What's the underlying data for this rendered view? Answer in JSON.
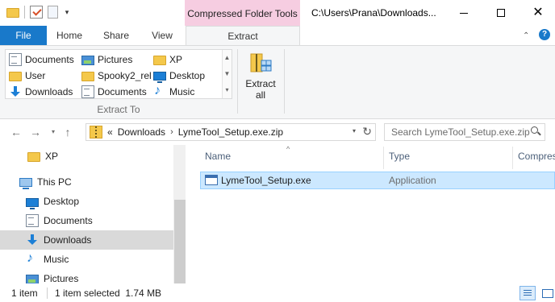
{
  "quick_access_toolbar": {
    "dropdown_glyph": "▾"
  },
  "ribbon_context": {
    "title": "Compressed Folder Tools"
  },
  "window": {
    "title": "C:\\Users\\Prana\\Downloads..."
  },
  "window_controls": {
    "minimize": "minimize",
    "maximize": "maximize",
    "close_glyph": "✕"
  },
  "ribbon_tabs": {
    "file": "File",
    "home": "Home",
    "share": "Share",
    "view": "View",
    "extract": "Extract",
    "active": "Extract"
  },
  "ribbon_right": {
    "collapse_glyph": "⌃",
    "help_glyph": "?"
  },
  "extract_to": {
    "group_label": "Extract To",
    "items": [
      {
        "label": "Documents",
        "icon": "documents-icon"
      },
      {
        "label": "Pictures",
        "icon": "pictures-icon"
      },
      {
        "label": "XP",
        "icon": "folder-icon"
      },
      {
        "label": "User",
        "icon": "folder-icon"
      },
      {
        "label": "Spooky2_rel",
        "icon": "folder-icon"
      },
      {
        "label": "Desktop",
        "icon": "desktop-icon"
      },
      {
        "label": "Downloads",
        "icon": "downloads-icon"
      },
      {
        "label": "Documents",
        "icon": "documents-icon"
      },
      {
        "label": "Music",
        "icon": "music-icon"
      }
    ],
    "scroll_up": "▲",
    "scroll_down": "▼",
    "more": "▾"
  },
  "extract_all": {
    "line1": "Extract",
    "line2": "all"
  },
  "navigation": {
    "back": "←",
    "forward": "→",
    "recent": "▾",
    "up": "↑"
  },
  "address": {
    "overflow": "«",
    "crumbs": [
      "Downloads",
      "LymeTool_Setup.exe.zip"
    ],
    "separator": "›",
    "dropdown": "▾",
    "refresh": "↻"
  },
  "search": {
    "placeholder": "Search LymeTool_Setup.exe.zip"
  },
  "nav_pane": {
    "items": [
      {
        "label": "XP",
        "icon": "folder-icon",
        "selected": false
      },
      {
        "label": "This PC",
        "icon": "this-pc-icon",
        "selected": false
      },
      {
        "label": "Desktop",
        "icon": "desktop-icon",
        "selected": false
      },
      {
        "label": "Documents",
        "icon": "documents-icon",
        "selected": false
      },
      {
        "label": "Downloads",
        "icon": "downloads-icon",
        "selected": true
      },
      {
        "label": "Music",
        "icon": "music-icon",
        "selected": false
      },
      {
        "label": "Pictures",
        "icon": "pictures-icon",
        "selected": false
      }
    ]
  },
  "file_list": {
    "sort_glyph": "^",
    "columns": [
      "Name",
      "Type",
      "Compres"
    ],
    "rows": [
      {
        "name": "LymeTool_Setup.exe",
        "type": "Application",
        "icon": "application-icon",
        "selected": true
      }
    ]
  },
  "status_bar": {
    "item_count": "1 item",
    "selection": "1 item selected  1.74 MB"
  },
  "colors": {
    "file_tab": "#1979ca",
    "context_tab": "#f6cde1",
    "selection": "#cce8ff",
    "nav_selected": "#d9d9d9"
  }
}
